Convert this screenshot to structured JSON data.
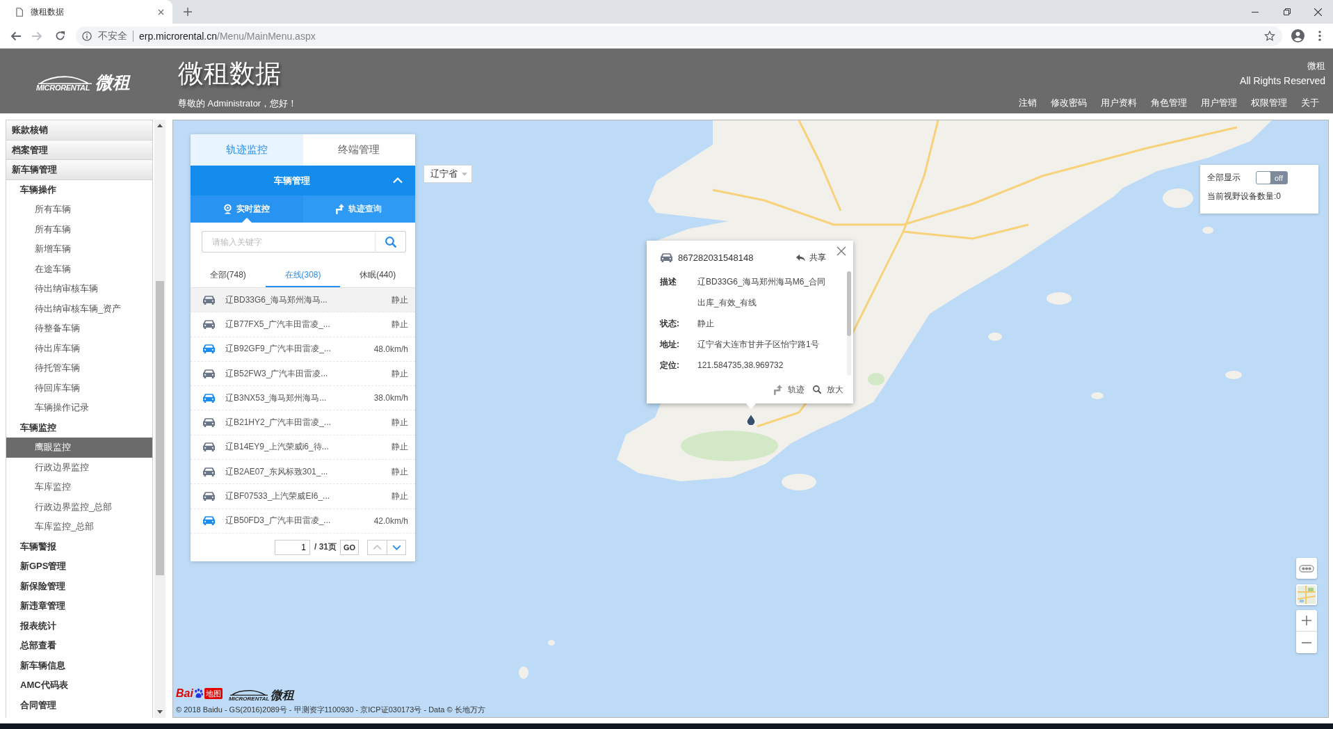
{
  "browser": {
    "tab_title": "微租数据",
    "security_label": "不安全",
    "url_host": "erp.microrental.cn",
    "url_path": "/Menu/MainMenu.aspx",
    "can_go_forward": false
  },
  "header": {
    "logo": {
      "wordmark": "MICRORENTAL",
      "mark": "微租"
    },
    "title": "微租数据",
    "greeting": "尊敬的 Administrator，您好！",
    "company": "微租",
    "copyright": "All Rights Reserved",
    "nav": [
      "注销",
      "修改密码",
      "用户资料",
      "角色管理",
      "用户管理",
      "权限管理",
      "关于"
    ]
  },
  "sidebar": {
    "items": [
      {
        "label": "账款核销",
        "selected": false
      },
      {
        "label": "档案管理",
        "selected": false
      },
      {
        "label": "新车辆管理",
        "selected": false,
        "children": [
          {
            "label": "车辆操作",
            "selected": false,
            "children": [
              {
                "label": "所有车辆",
                "selected": false
              },
              {
                "label": "所有车辆",
                "selected": false
              },
              {
                "label": "新增车辆",
                "selected": false
              },
              {
                "label": "在途车辆",
                "selected": false
              },
              {
                "label": "待出纳审核车辆",
                "selected": false
              },
              {
                "label": "待出纳审核车辆_资产",
                "selected": false
              },
              {
                "label": "待整备车辆",
                "selected": false
              },
              {
                "label": "待出库车辆",
                "selected": false
              },
              {
                "label": "待托管车辆",
                "selected": false
              },
              {
                "label": "待回库车辆",
                "selected": false
              },
              {
                "label": "车辆操作记录",
                "selected": false
              }
            ]
          },
          {
            "label": "车辆监控",
            "selected": false,
            "children": [
              {
                "label": "鹰眼监控",
                "selected": true
              },
              {
                "label": "行政边界监控",
                "selected": false
              },
              {
                "label": "车库监控",
                "selected": false
              },
              {
                "label": "行政边界监控_总部",
                "selected": false
              },
              {
                "label": "车库监控_总部",
                "selected": false
              }
            ]
          },
          {
            "label": "车辆警报",
            "selected": false
          },
          {
            "label": "新GPS管理",
            "selected": false
          },
          {
            "label": "新保险管理",
            "selected": false
          },
          {
            "label": "新违章管理",
            "selected": false
          },
          {
            "label": "报表统计",
            "selected": false
          },
          {
            "label": "总部查看",
            "selected": false
          },
          {
            "label": "新车辆信息",
            "selected": false
          },
          {
            "label": "AMC代码表",
            "selected": false
          },
          {
            "label": "合同管理",
            "selected": false
          }
        ]
      }
    ]
  },
  "panel": {
    "tabs": [
      {
        "label": "轨迹监控",
        "selected": true
      },
      {
        "label": "终端管理",
        "selected": false
      }
    ],
    "section_title": "车辆管理",
    "section_expanded": true,
    "modes": [
      {
        "label": "实时监控",
        "kind": "live",
        "selected": true
      },
      {
        "label": "轨迹查询",
        "kind": "track",
        "selected": false
      }
    ],
    "search": {
      "placeholder": "请输入关键字"
    },
    "filters": [
      {
        "label": "全部(748)",
        "selected": false
      },
      {
        "label": "在线(308)",
        "selected": true
      },
      {
        "label": "休眠(440)",
        "selected": false
      }
    ],
    "vehicles": [
      {
        "name": "辽BD33G6_海马郑州海马...",
        "status": "静止",
        "moving": false,
        "selected": true
      },
      {
        "name": "辽B77FX5_广汽丰田雷凌_...",
        "status": "静止",
        "moving": false,
        "selected": false
      },
      {
        "name": "辽B92GF9_广汽丰田雷凌_...",
        "status": "48.0km/h",
        "moving": true,
        "selected": false
      },
      {
        "name": "辽B52FW3_广汽丰田雷凌...",
        "status": "静止",
        "moving": false,
        "selected": false
      },
      {
        "name": "辽B3NX53_海马郑州海马...",
        "status": "38.0km/h",
        "moving": true,
        "selected": false
      },
      {
        "name": "辽B21HY2_广汽丰田雷凌_...",
        "status": "静止",
        "moving": false,
        "selected": false
      },
      {
        "name": "辽B14EY9_上汽荣威i6_待...",
        "status": "静止",
        "moving": false,
        "selected": false
      },
      {
        "name": "辽B2AE07_东风标致301_...",
        "status": "静止",
        "moving": false,
        "selected": false
      },
      {
        "name": "辽BF07533_上汽荣威EI6_...",
        "status": "静止",
        "moving": false,
        "selected": false
      },
      {
        "name": "辽B50FD3_广汽丰田雷凌_...",
        "status": "42.0km/h",
        "moving": true,
        "selected": false
      }
    ],
    "pagination": {
      "page": "1",
      "total": "/ 31页",
      "go": "GO",
      "can_prev": false,
      "can_next": true
    }
  },
  "map": {
    "province_select": "辽宁省",
    "popup": {
      "device_id": "867282031548148",
      "share": "共享",
      "fields": [
        {
          "label": "描述",
          "value": "辽BD33G6_海马郑州海马M6_合同出库_有效_有线"
        },
        {
          "label": "状态:",
          "value": "静止"
        },
        {
          "label": "地址:",
          "value": "辽宁省大连市甘井子区怡宁路1号"
        },
        {
          "label": "定位:",
          "value": "121.584735,38.969732"
        }
      ],
      "actions": [
        {
          "label": "轨迹",
          "kind": "track"
        },
        {
          "label": "放大",
          "kind": "zoom"
        }
      ]
    },
    "display_panel": {
      "show_all_label": "全部显示",
      "show_all_on": false,
      "toggle_text": "off",
      "device_count": "当前视野设备数量:0"
    },
    "provider_logo": {
      "left": "Bai",
      "right": "地图"
    },
    "partner_logo": {
      "wordmark": "MICRORENTAL",
      "mark": "微租"
    },
    "copyright": "© 2018 Baidu - GS(2016)2089号 - 甲测资字1100930 - 京ICP证030173号 - Data © 长地万方"
  }
}
